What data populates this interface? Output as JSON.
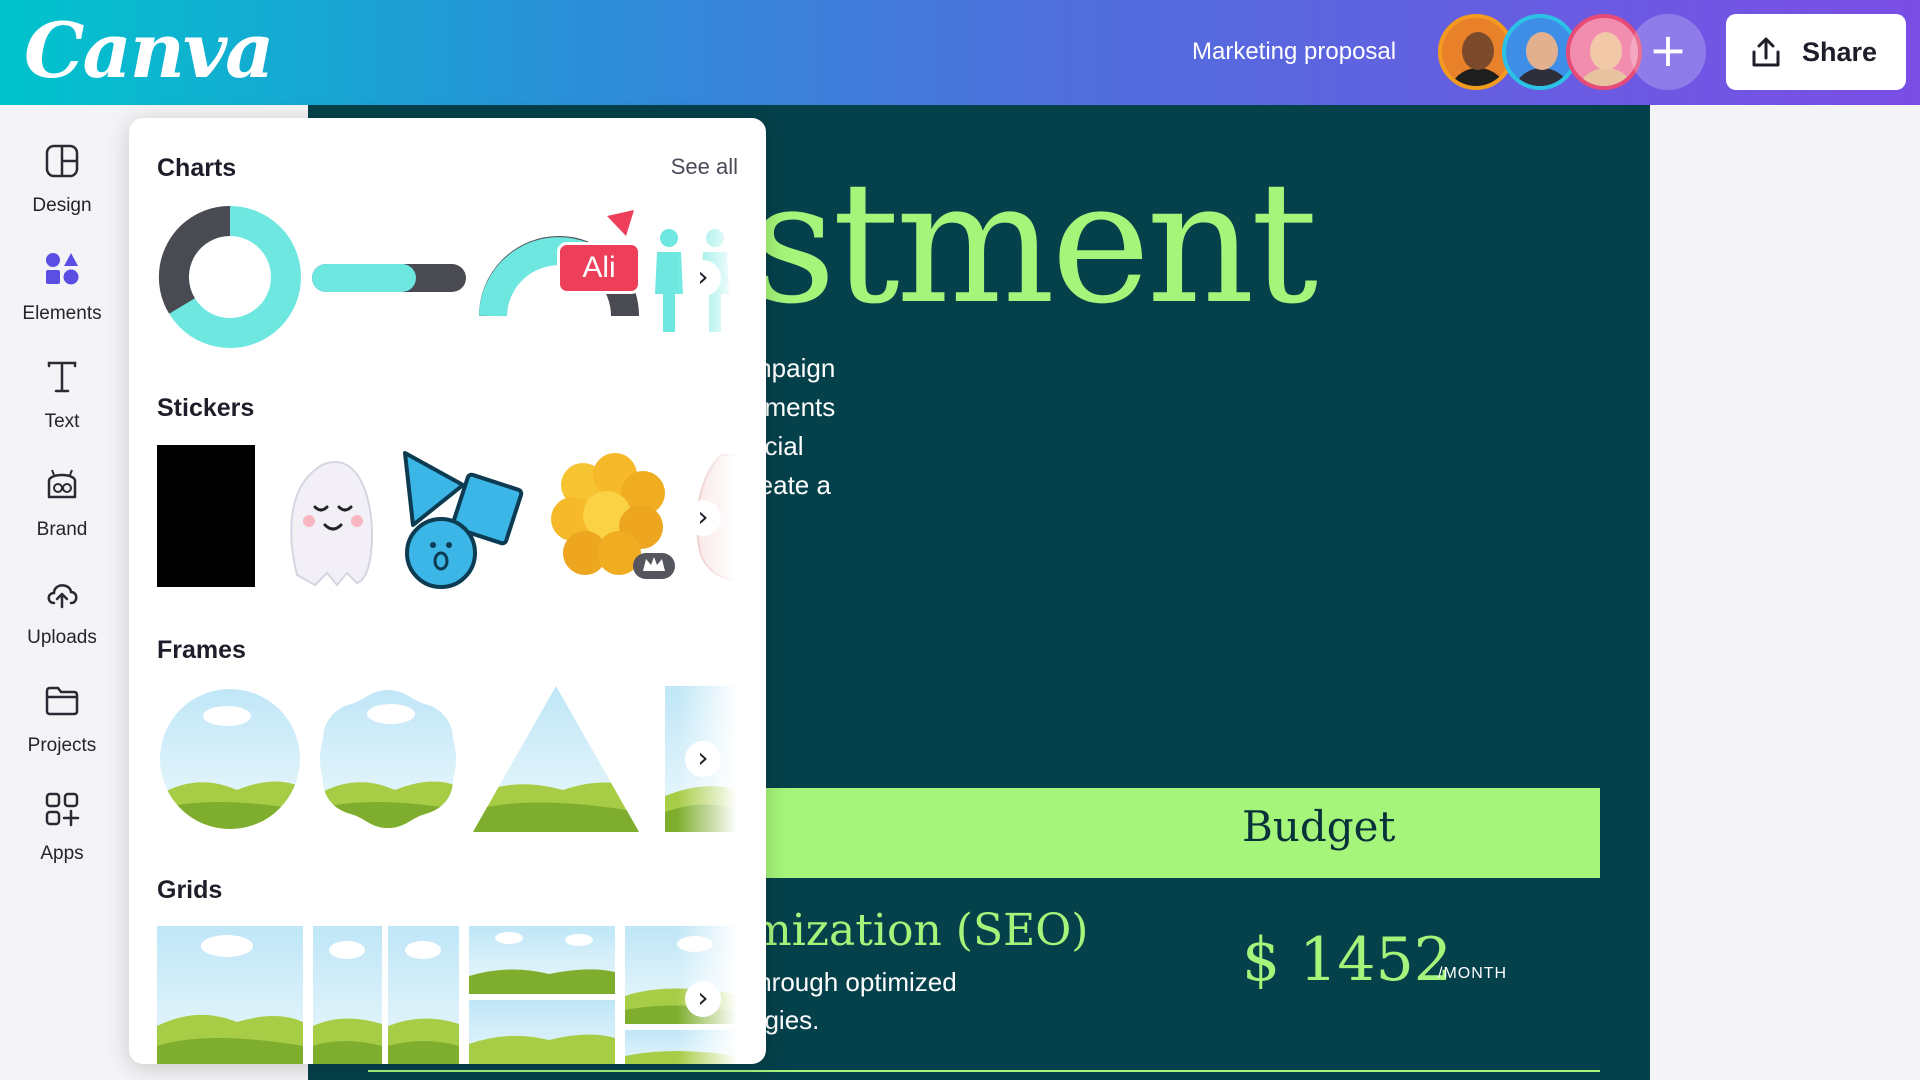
{
  "header": {
    "logo": "Canva",
    "doc_title": "Marketing proposal",
    "add_label": "+",
    "share_label": "Share",
    "avatars": [
      {
        "name": "collaborator-1",
        "ring": "#f29b1f",
        "bg": "#e9812a",
        "skin": "#7b4a2b",
        "shirt": "#1e1e1e"
      },
      {
        "name": "collaborator-2",
        "ring": "#2bc2e6",
        "bg": "#3e8de6",
        "skin": "#e3b08f",
        "shirt": "#2f2f3a"
      },
      {
        "name": "collaborator-3",
        "ring": "#e64a76",
        "bg": "#f28db0",
        "skin": "#f2c9a8",
        "shirt": "#e7c3a0"
      }
    ]
  },
  "rail": {
    "items": [
      {
        "label": "Design",
        "icon": "design-icon"
      },
      {
        "label": "Elements",
        "icon": "elements-icon"
      },
      {
        "label": "Text",
        "icon": "text-icon"
      },
      {
        "label": "Brand",
        "icon": "brand-icon"
      },
      {
        "label": "Uploads",
        "icon": "uploads-icon"
      },
      {
        "label": "Projects",
        "icon": "projects-icon"
      },
      {
        "label": "Apps",
        "icon": "apps-icon"
      }
    ]
  },
  "panel": {
    "charts_title": "Charts",
    "see_all": "See all",
    "stickers_title": "Stickers",
    "frames_title": "Frames",
    "grids_title": "Grids",
    "ali_badge": "Ali",
    "chevron": "›"
  },
  "slide": {
    "title": "stment",
    "body_lines": [
      "mpaign",
      "ements",
      "ocial",
      "reate a"
    ],
    "budget": "Budget",
    "seo_title": "mization (SEO)",
    "seo_lines": [
      " through optimized",
      "egies."
    ],
    "price": "$ 1452",
    "per_month": "/MONTH"
  },
  "colors": {
    "slide_bg": "#05414b",
    "accent_green": "#a5f57a",
    "teal": "#6ee7e0",
    "dark_gray": "#4a4a52"
  }
}
